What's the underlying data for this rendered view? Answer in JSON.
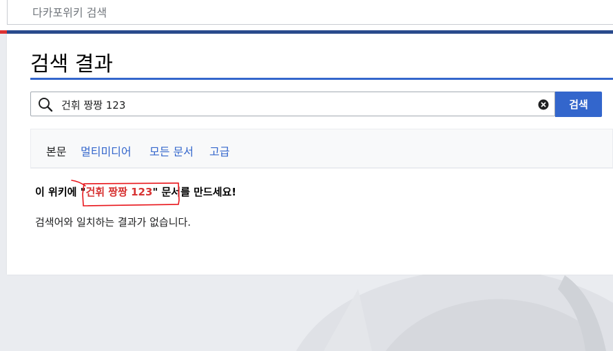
{
  "top_search": {
    "placeholder": "다카포위키 검색"
  },
  "page": {
    "title": "검색 결과",
    "search": {
      "value": "건휘 짱짱 123",
      "button_label": "검색"
    },
    "profiles": [
      {
        "label": "본문",
        "active": true
      },
      {
        "label": "멀티미디어",
        "active": false
      },
      {
        "label": "모든 문서",
        "active": false
      },
      {
        "label": "고급",
        "active": false
      }
    ],
    "create_notice": {
      "prefix": "이 위키에 \"",
      "term": "건휘 짱짱 123",
      "suffix": "\" 문서를 만드세요!"
    },
    "no_results": "검색어와 일치하는 결과가 없습니다."
  },
  "colors": {
    "accent": "#3366cc",
    "brand_stripe": "#2a4b8d",
    "red_link": "#d73333",
    "annotation": "#e8141a"
  },
  "icons": [
    "search-icon",
    "clear-icon"
  ]
}
